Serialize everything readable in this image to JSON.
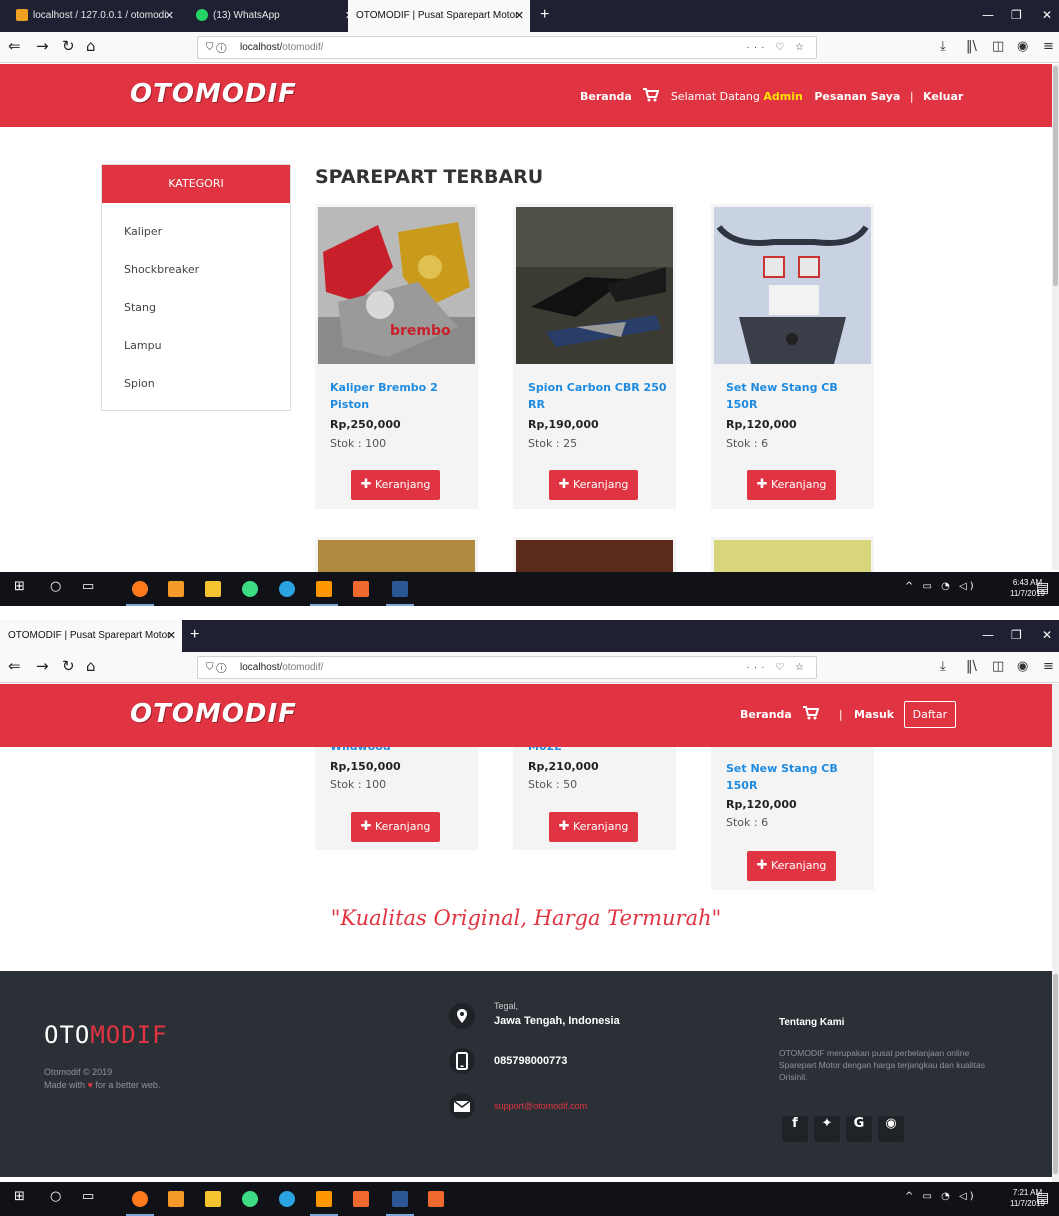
{
  "browser1": {
    "tabs": [
      {
        "label": "localhost / 127.0.0.1 / otomodi",
        "active": false
      },
      {
        "label": "(13) WhatsApp",
        "active": false
      },
      {
        "label": "OTOMODIF | Pusat Sparepart Motor",
        "active": true
      }
    ],
    "url_host": "localhost/",
    "url_path": "otomodif/",
    "url_actions": "··· ♡ ☆"
  },
  "browser2": {
    "tabs": [
      {
        "label": "OTOMODIF | Pusat Sparepart Motor",
        "active": true
      }
    ],
    "url_host": "localhost/",
    "url_path": "otomodif/",
    "url_actions": "··· ♡ ☆"
  },
  "site": {
    "logo": "OTOMODIF",
    "nav_home": "Beranda",
    "welcome_text": "Selamat Datang",
    "welcome_user": "Admin",
    "nav_orders": "Pesanan Saya",
    "nav_sep": "|",
    "nav_logout": "Keluar",
    "nav_login": "Masuk",
    "nav_register": "Daftar"
  },
  "sidebar": {
    "title": "KATEGORI",
    "items": [
      "Kaliper",
      "Shockbreaker",
      "Stang",
      "Lampu",
      "Spion"
    ]
  },
  "section_title": "SPAREPART TERBARU",
  "products_row1": [
    {
      "name_l1": "Kaliper Brembo 2",
      "name_l2": "Piston",
      "price": "Rp,250,000",
      "stock": "Stok : 100",
      "button": "Keranjang"
    },
    {
      "name_l1": "Spion Carbon CBR 250",
      "name_l2": "RR",
      "price": "Rp,190,000",
      "stock": "Stok : 25",
      "button": "Keranjang"
    },
    {
      "name_l1": "Set New Stang CB",
      "name_l2": "150R",
      "price": "Rp,120,000",
      "stock": "Stok : 6",
      "button": "Keranjang"
    }
  ],
  "products_row2": [
    {
      "name_tail": "Wildwood",
      "price": "Rp,150,000",
      "stock": "Stok : 100",
      "button": "Keranjang"
    },
    {
      "name_tail": "M02E",
      "price": "Rp,210,000",
      "stock": "Stok : 50",
      "button": "Keranjang"
    },
    {
      "name_l1": "Set New Stang CB",
      "name_l2": "150R",
      "price": "Rp,120,000",
      "stock": "Stok : 6",
      "button": "Keranjang"
    }
  ],
  "tagline": "\"Kualitas Original, Harga Termurah\"",
  "footer": {
    "logo_a": "OTO",
    "logo_b": "MODIF",
    "copyright": "Otomodif © 2019",
    "made_with_a": "Made with",
    "made_with_b": "for a better web.",
    "city": "Tegal,",
    "region": "Jawa Tengah, Indonesia",
    "phone": "085798000773",
    "email": "support@otomodif.com",
    "about_title": "Tentang Kami",
    "about_text": "OTOMODIF merupakan pusat perbelanjaan online Sparepart Motor dengan harga terjangkau dan kualitas Orisinil."
  },
  "taskbar1": {
    "time": "6:43 AM",
    "date": "11/7/2019"
  },
  "taskbar2": {
    "time": "7:21 AM",
    "date": "11/7/2019"
  },
  "colors": {
    "brand_red": "#e03442",
    "link_blue": "#1f8be0",
    "footer_bg": "#2b3036",
    "admin_yellow": "#ffe400"
  }
}
